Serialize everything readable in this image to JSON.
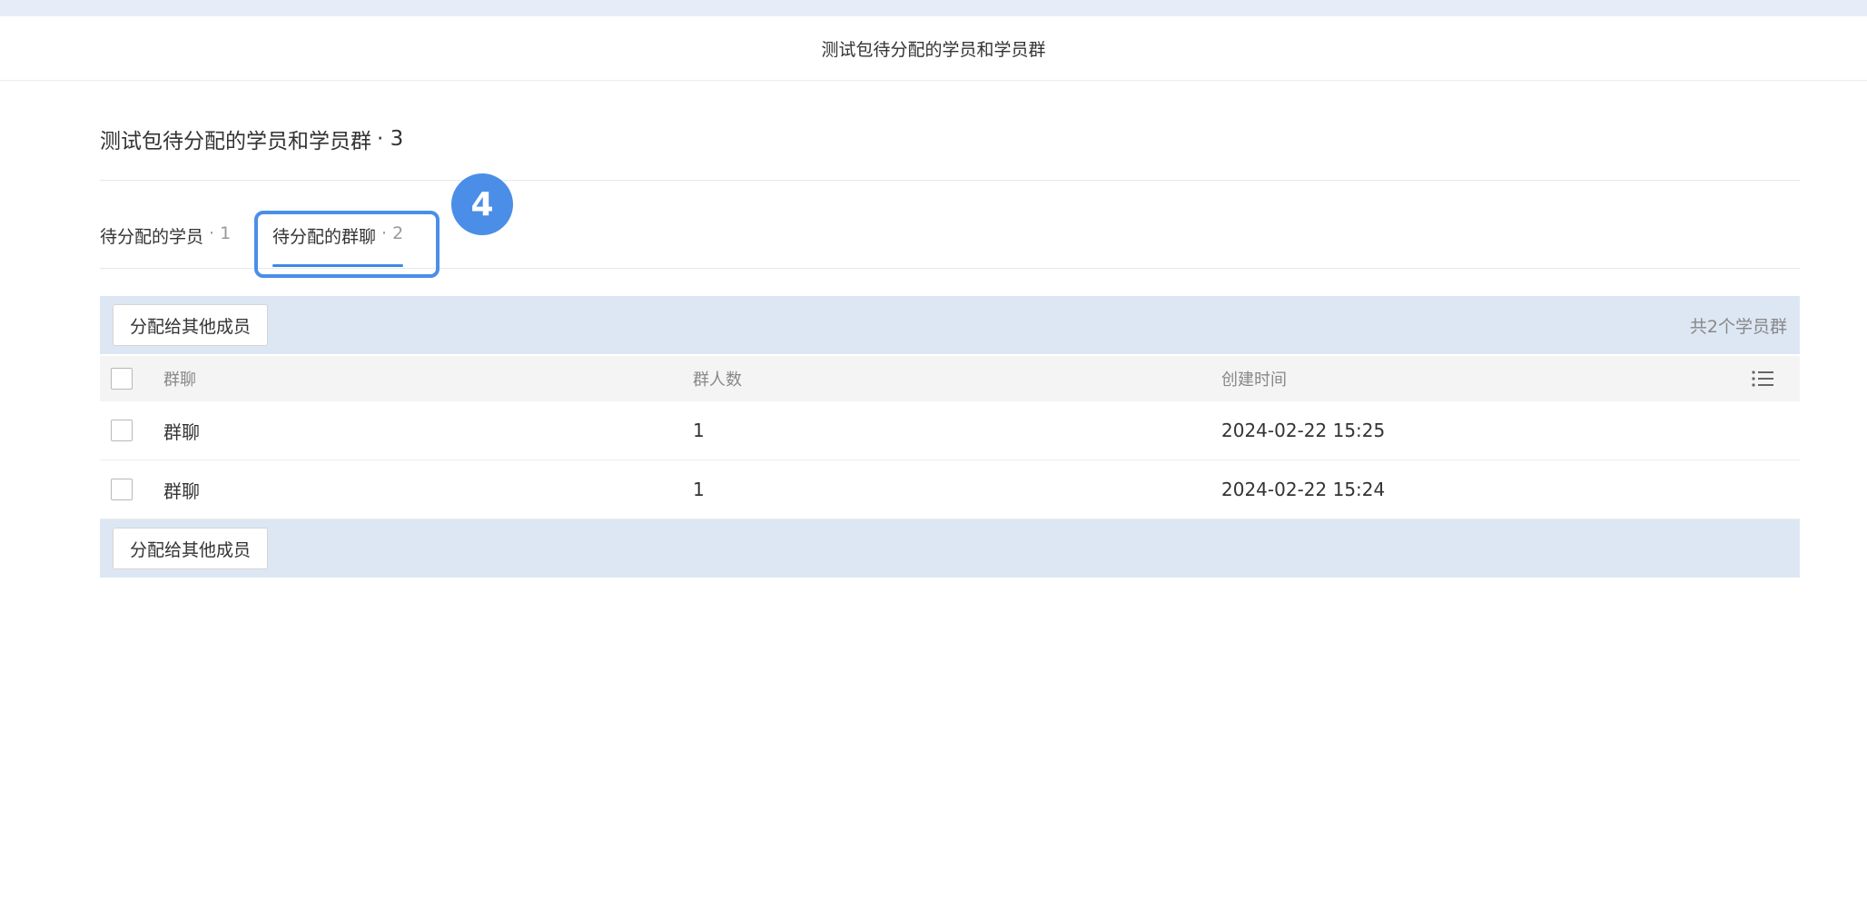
{
  "header": {
    "title": "测试包待分配的学员和学员群"
  },
  "page": {
    "title": "测试包待分配的学员和学员群",
    "count": "· 3"
  },
  "tabs": [
    {
      "label": "待分配的学员",
      "count": "· 1"
    },
    {
      "label": "待分配的群聊",
      "count": "· 2"
    }
  ],
  "step_badge": "4",
  "toolbar": {
    "assign_label": "分配给其他成员",
    "total_text": "共2个学员群"
  },
  "table": {
    "columns": [
      "群聊",
      "群人数",
      "创建时间"
    ],
    "rows": [
      {
        "name": "群聊",
        "members": "1",
        "created": "2024-02-22 15:25"
      },
      {
        "name": "群聊",
        "members": "1",
        "created": "2024-02-22 15:24"
      }
    ]
  },
  "icons": {
    "column_settings": "list-settings-icon"
  },
  "colors": {
    "accent": "#3a89e8",
    "toolbar_bg": "#dde7f4"
  }
}
